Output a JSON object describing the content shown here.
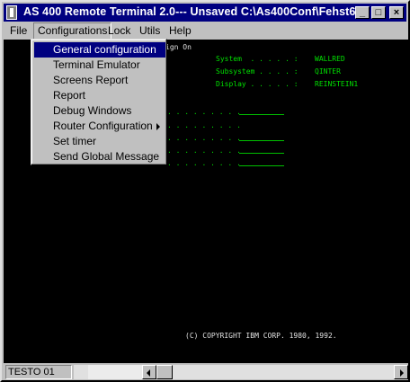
{
  "window": {
    "title": "AS 400 Remote Terminal 2.0--- Unsaved C:\\As400Conf\\Fehst6",
    "minimize_glyph": "_",
    "maximize_glyph": "□",
    "close_glyph": "×"
  },
  "menubar": {
    "items": [
      "File",
      "Configurations",
      "Lock",
      "Utils",
      "Help"
    ]
  },
  "dropdown": {
    "items": [
      {
        "label": "General configuration",
        "selected": true
      },
      {
        "label": "Terminal Emulator"
      },
      {
        "label": "Screens Report"
      },
      {
        "label": "Report"
      },
      {
        "label": "Debug Windows"
      },
      {
        "label": "Router Configuration",
        "submenu": true
      },
      {
        "label": "Set timer"
      },
      {
        "label": "Send Global Message"
      }
    ]
  },
  "terminal": {
    "signon_title": "ign On",
    "system_label": "System  . . . . . :",
    "system_value": "WALLRED",
    "subsystem_label": "Subsystem . . . . :",
    "subsystem_value": "QINTER",
    "display_label": "Display . . . . . :",
    "display_value": "REINSTEIN1",
    "dots_line": ". . . . . . . . .",
    "copyright": "(C) COPYRIGHT IBM CORP. 1980, 1992."
  },
  "statusbar": {
    "session": "TESTO 01"
  }
}
